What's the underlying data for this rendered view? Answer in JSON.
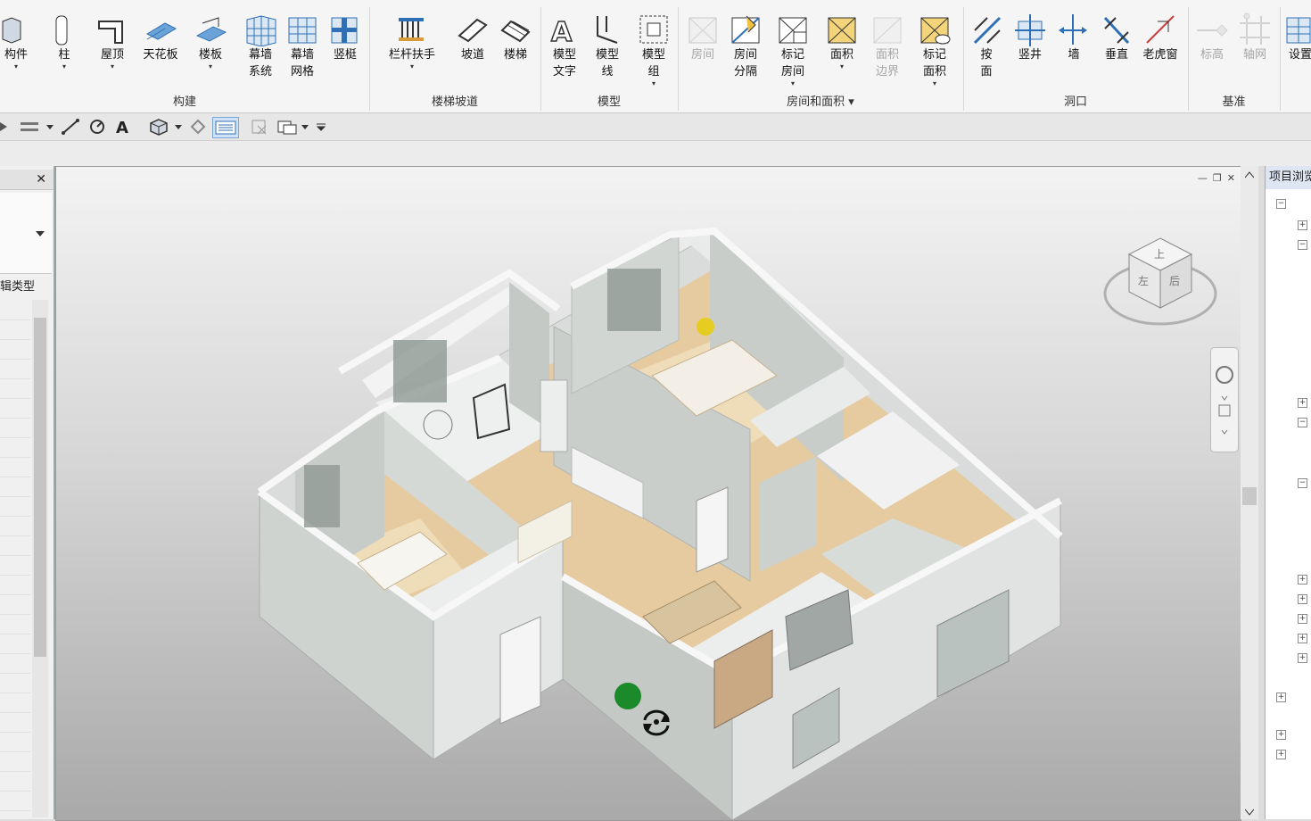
{
  "ribbon": {
    "tools": [
      {
        "label": "构件",
        "icon": "component-icon",
        "dropdown": true
      },
      {
        "label": "柱",
        "icon": "column-icon",
        "dropdown": true
      },
      {
        "label": "屋顶",
        "icon": "roof-icon",
        "dropdown": true
      },
      {
        "label": "天花板",
        "icon": "ceiling-icon",
        "dropdown": false
      },
      {
        "label": "楼板",
        "icon": "floor-icon",
        "dropdown": true
      },
      {
        "label": "幕墙\n系统",
        "icon": "curtain-system-icon",
        "dropdown": false
      },
      {
        "label": "幕墙\n网格",
        "icon": "curtain-grid-icon",
        "dropdown": false
      },
      {
        "label": "竖梃",
        "icon": "mullion-icon",
        "dropdown": false
      },
      {
        "label": "栏杆扶手",
        "icon": "railing-icon",
        "dropdown": true
      },
      {
        "label": "坡道",
        "icon": "ramp-icon",
        "dropdown": false
      },
      {
        "label": "楼梯",
        "icon": "stair-icon",
        "dropdown": false
      },
      {
        "label": "模型\n文字",
        "icon": "model-text-icon",
        "dropdown": false
      },
      {
        "label": "模型\n线",
        "icon": "model-line-icon",
        "dropdown": false
      },
      {
        "label": "模型\n组",
        "icon": "model-group-icon",
        "dropdown": true
      },
      {
        "label": "房间",
        "icon": "room-icon",
        "dropdown": false,
        "disabled": true
      },
      {
        "label": "房间\n分隔",
        "icon": "room-separator-icon",
        "dropdown": false
      },
      {
        "label": "标记\n房间",
        "icon": "tag-room-icon",
        "dropdown": true
      },
      {
        "label": "面积",
        "icon": "area-icon",
        "dropdown": true
      },
      {
        "label": "面积\n边界",
        "icon": "area-boundary-icon",
        "dropdown": false,
        "disabled": true
      },
      {
        "label": "标记\n面积",
        "icon": "tag-area-icon",
        "dropdown": true
      },
      {
        "label": "按\n面",
        "icon": "by-face-icon",
        "dropdown": false
      },
      {
        "label": "竖井",
        "icon": "shaft-icon",
        "dropdown": false
      },
      {
        "label": "墙",
        "icon": "wall-opening-icon",
        "dropdown": false
      },
      {
        "label": "垂直",
        "icon": "vertical-opening-icon",
        "dropdown": false
      },
      {
        "label": "老虎窗",
        "icon": "dormer-icon",
        "dropdown": false
      },
      {
        "label": "标高",
        "icon": "level-icon",
        "dropdown": false,
        "disabled": true
      },
      {
        "label": "轴网",
        "icon": "grid-icon",
        "dropdown": false,
        "disabled": true
      },
      {
        "label": "设置",
        "icon": "settings-icon",
        "dropdown": false
      }
    ],
    "groups": [
      {
        "label": "构建"
      },
      {
        "label": "楼梯坡道"
      },
      {
        "label": "模型"
      },
      {
        "label": "房间和面积 ▾"
      },
      {
        "label": "洞口"
      },
      {
        "label": "基准"
      }
    ]
  },
  "properties": {
    "edit_type": "辑类型",
    "close": "✕"
  },
  "browser": {
    "title": "项目浏览器"
  },
  "viewport": {
    "viewcube_faces": {
      "top": "上",
      "left": "左",
      "back": "后"
    },
    "window_controls": [
      "—",
      "❐",
      "✕"
    ]
  },
  "colors": {
    "ribbon_bg": "#f5f5f5",
    "icon_blue": "#2f6fb5",
    "wall": "#d7dbd8",
    "wood_floor": "#e6caa0",
    "orbit_dot": "#1a8a2a"
  }
}
